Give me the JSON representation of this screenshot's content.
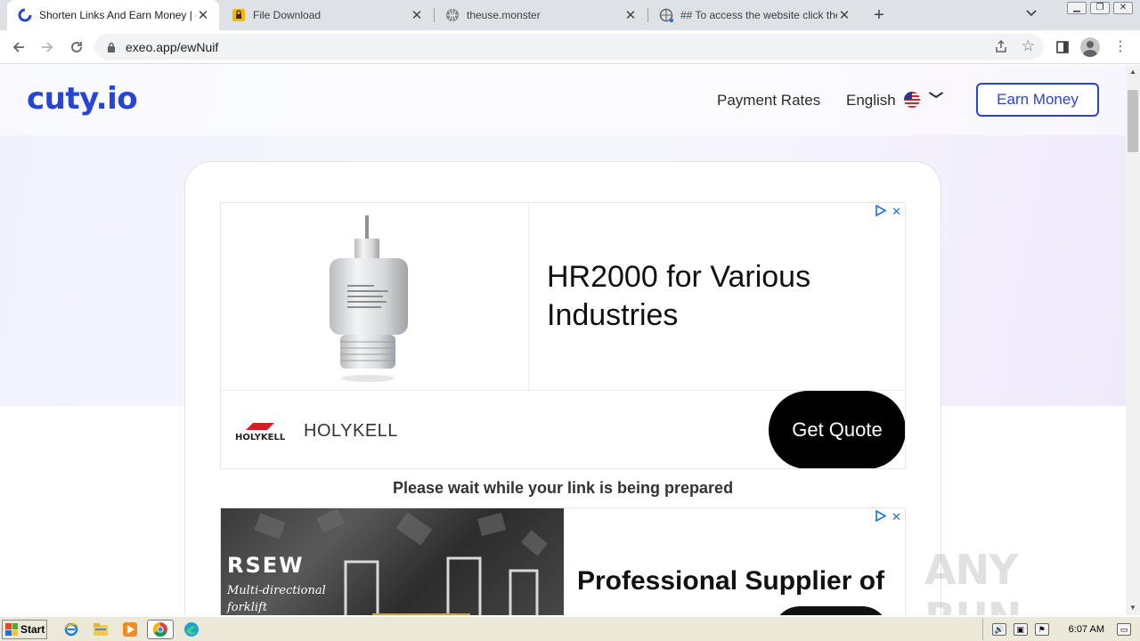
{
  "browser": {
    "tabs": [
      {
        "title": "Shorten Links And Earn Money | cuty",
        "active": true,
        "favicon": "cuty-icon"
      },
      {
        "title": "File Download",
        "active": false,
        "favicon": "lock-file-icon"
      },
      {
        "title": "theuse.monster",
        "active": false,
        "favicon": "globe-icon"
      },
      {
        "title": "## To access the website click the \"A",
        "active": false,
        "favicon": "globe-loading-icon"
      }
    ],
    "new_tab_label": "+",
    "url": "exeo.app/ewNuif"
  },
  "site": {
    "logo_text": "cuty.io",
    "nav": {
      "payment_rates": "Payment Rates",
      "language": "English",
      "earn_money": "Earn Money"
    },
    "brand_color": "#2744d8"
  },
  "ad1": {
    "headline": "HR2000 for Various Industries",
    "brand": "HOLYKELL",
    "brand_logo_text": "HOLYKELL",
    "cta": "Get Quote"
  },
  "wait_message": "Please wait while your link is being prepared",
  "ad2": {
    "logo_text": "RSEW",
    "tagline_1": "Multi-directional",
    "tagline_2": "forklift",
    "headline": "Professional Supplier of"
  },
  "watermark": "ANY RUN",
  "taskbar": {
    "start_label": "Start",
    "clock": "6:07 AM"
  }
}
